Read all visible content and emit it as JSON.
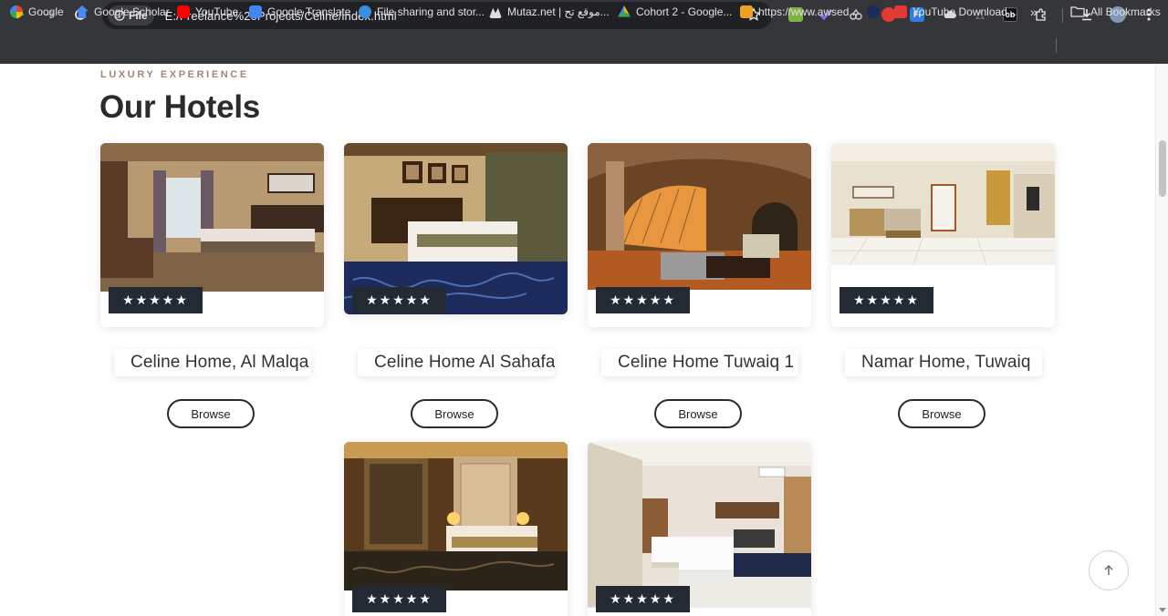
{
  "browser": {
    "site_chip": "File",
    "url": "E:/Freelance%20Projects/Celine/index.html",
    "bookmarks": [
      {
        "label": "Google",
        "icon": "google-icon",
        "color": "#4285f4"
      },
      {
        "label": "Google Scholar",
        "icon": "scholar-icon",
        "color": "#4a8af4"
      },
      {
        "label": "YouTube",
        "icon": "youtube-icon",
        "color": "#ff0000"
      },
      {
        "label": "Google Translate",
        "icon": "translate-icon",
        "color": "#4285f4"
      },
      {
        "label": "File sharing and stor...",
        "icon": "file-share-icon",
        "color": "#3a8ee6"
      },
      {
        "label": "Mutaz.net | موقع تح...",
        "icon": "mutaz-icon",
        "color": "#dddddd"
      },
      {
        "label": "Cohort 2 - Google...",
        "icon": "drive-icon",
        "color": "#fbbc04"
      },
      {
        "label": "https://www.awsed...",
        "icon": "aws-icon",
        "color": "#f0a020"
      },
      {
        "label": "",
        "icon": "globe-icon",
        "color": "#1a2a5a"
      },
      {
        "label": "YouTube Download...",
        "icon": "download-bm-icon",
        "color": "#e53935"
      }
    ],
    "more_bookmarks": "»",
    "all_bookmarks": "All Bookmarks"
  },
  "section": {
    "eyebrow": "LUXURY EXPERIENCE",
    "title": "Our Hotels"
  },
  "hotels": [
    {
      "name": "Celine Home, Al Malqa",
      "browse_label": "Browse",
      "rating": 5,
      "stars": "★★★★★"
    },
    {
      "name": "Celine Home Al Sahafa",
      "browse_label": "Browse",
      "rating": 5,
      "stars": "★★★★★"
    },
    {
      "name": "Celine Home Tuwaiq 1",
      "browse_label": "Browse",
      "rating": 5,
      "stars": "★★★★★"
    },
    {
      "name": "Namar Home, Tuwaiq",
      "browse_label": "Browse",
      "rating": 5,
      "stars": "★★★★★"
    },
    {
      "name": "",
      "browse_label": "",
      "rating": 5,
      "stars": "★★★★★"
    },
    {
      "name": "",
      "browse_label": "",
      "rating": 5,
      "stars": "★★★★★"
    }
  ],
  "colors": {
    "accent": "#a0896e",
    "rating_badge": "#232a33",
    "chrome": "#35363a"
  }
}
